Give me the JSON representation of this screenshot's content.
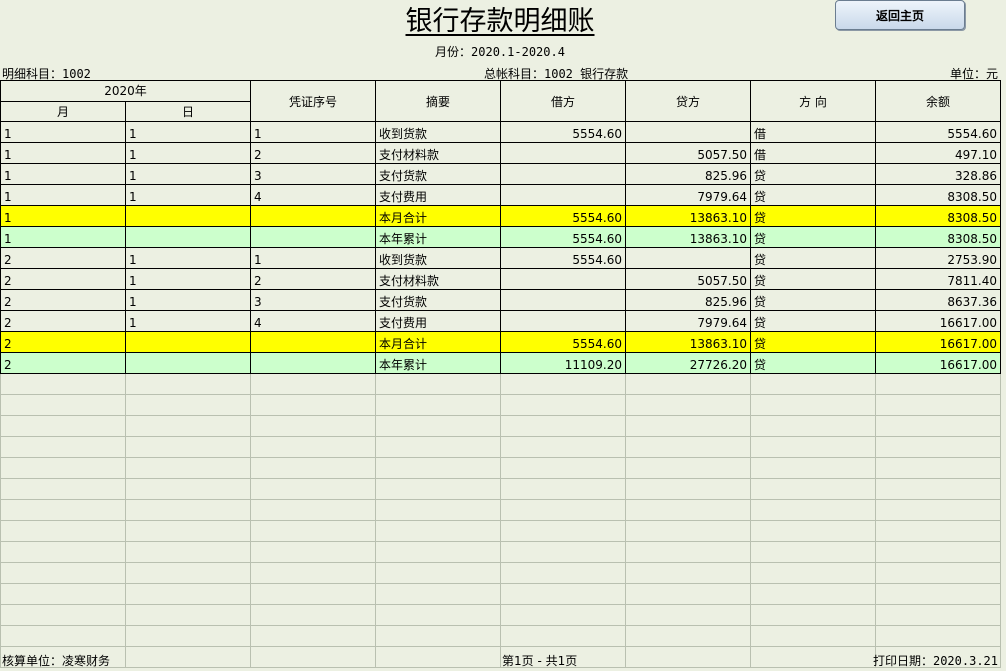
{
  "title": "银行存款明细账",
  "back_button": "返回主页",
  "period": "月份：2020.1-2020.4",
  "detail_account": "明细科目：1002",
  "general_account": "总帐科目：1002  银行存款",
  "unit": "单位：元",
  "headers": {
    "year": "2020年",
    "month": "月",
    "day": "日",
    "voucher": "凭证序号",
    "summary": "摘要",
    "debit": "借方",
    "credit": "贷方",
    "direction": "方 向",
    "balance": "余额"
  },
  "rows": [
    {
      "month": "1",
      "day": "1",
      "voucher": "1",
      "summary": "收到货款",
      "debit": "5554.60",
      "credit": "",
      "direction": "借",
      "balance": "5554.60",
      "type": "normal"
    },
    {
      "month": "1",
      "day": "1",
      "voucher": "2",
      "summary": "支付材料款",
      "debit": "",
      "credit": "5057.50",
      "direction": "借",
      "balance": "497.10",
      "type": "normal"
    },
    {
      "month": "1",
      "day": "1",
      "voucher": "3",
      "summary": "支付货款",
      "debit": "",
      "credit": "825.96",
      "direction": "贷",
      "balance": "328.86",
      "type": "normal"
    },
    {
      "month": "1",
      "day": "1",
      "voucher": "4",
      "summary": "支付费用",
      "debit": "",
      "credit": "7979.64",
      "direction": "贷",
      "balance": "8308.50",
      "type": "normal"
    },
    {
      "month": "1",
      "day": "",
      "voucher": "",
      "summary": "本月合计",
      "debit": "5554.60",
      "credit": "13863.10",
      "direction": "贷",
      "balance": "8308.50",
      "type": "month"
    },
    {
      "month": "1",
      "day": "",
      "voucher": "",
      "summary": "本年累计",
      "debit": "5554.60",
      "credit": "13863.10",
      "direction": "贷",
      "balance": "8308.50",
      "type": "year"
    },
    {
      "month": "2",
      "day": "1",
      "voucher": "1",
      "summary": "收到货款",
      "debit": "5554.60",
      "credit": "",
      "direction": "贷",
      "balance": "2753.90",
      "type": "normal"
    },
    {
      "month": "2",
      "day": "1",
      "voucher": "2",
      "summary": "支付材料款",
      "debit": "",
      "credit": "5057.50",
      "direction": "贷",
      "balance": "7811.40",
      "type": "normal"
    },
    {
      "month": "2",
      "day": "1",
      "voucher": "3",
      "summary": "支付货款",
      "debit": "",
      "credit": "825.96",
      "direction": "贷",
      "balance": "8637.36",
      "type": "normal"
    },
    {
      "month": "2",
      "day": "1",
      "voucher": "4",
      "summary": "支付费用",
      "debit": "",
      "credit": "7979.64",
      "direction": "贷",
      "balance": "16617.00",
      "type": "normal"
    },
    {
      "month": "2",
      "day": "",
      "voucher": "",
      "summary": "本月合计",
      "debit": "5554.60",
      "credit": "13863.10",
      "direction": "贷",
      "balance": "16617.00",
      "type": "month"
    },
    {
      "month": "2",
      "day": "",
      "voucher": "",
      "summary": "本年累计",
      "debit": "11109.20",
      "credit": "27726.20",
      "direction": "贷",
      "balance": "16617.00",
      "type": "year"
    }
  ],
  "footer": {
    "company": "核算单位：凌寒财务",
    "page": "第1页 - 共1页",
    "print_date": "打印日期：2020.3.21"
  },
  "colors": {
    "background": "#ecf0e2",
    "month_total": "#ffff00",
    "year_total": "#ccffcc"
  }
}
